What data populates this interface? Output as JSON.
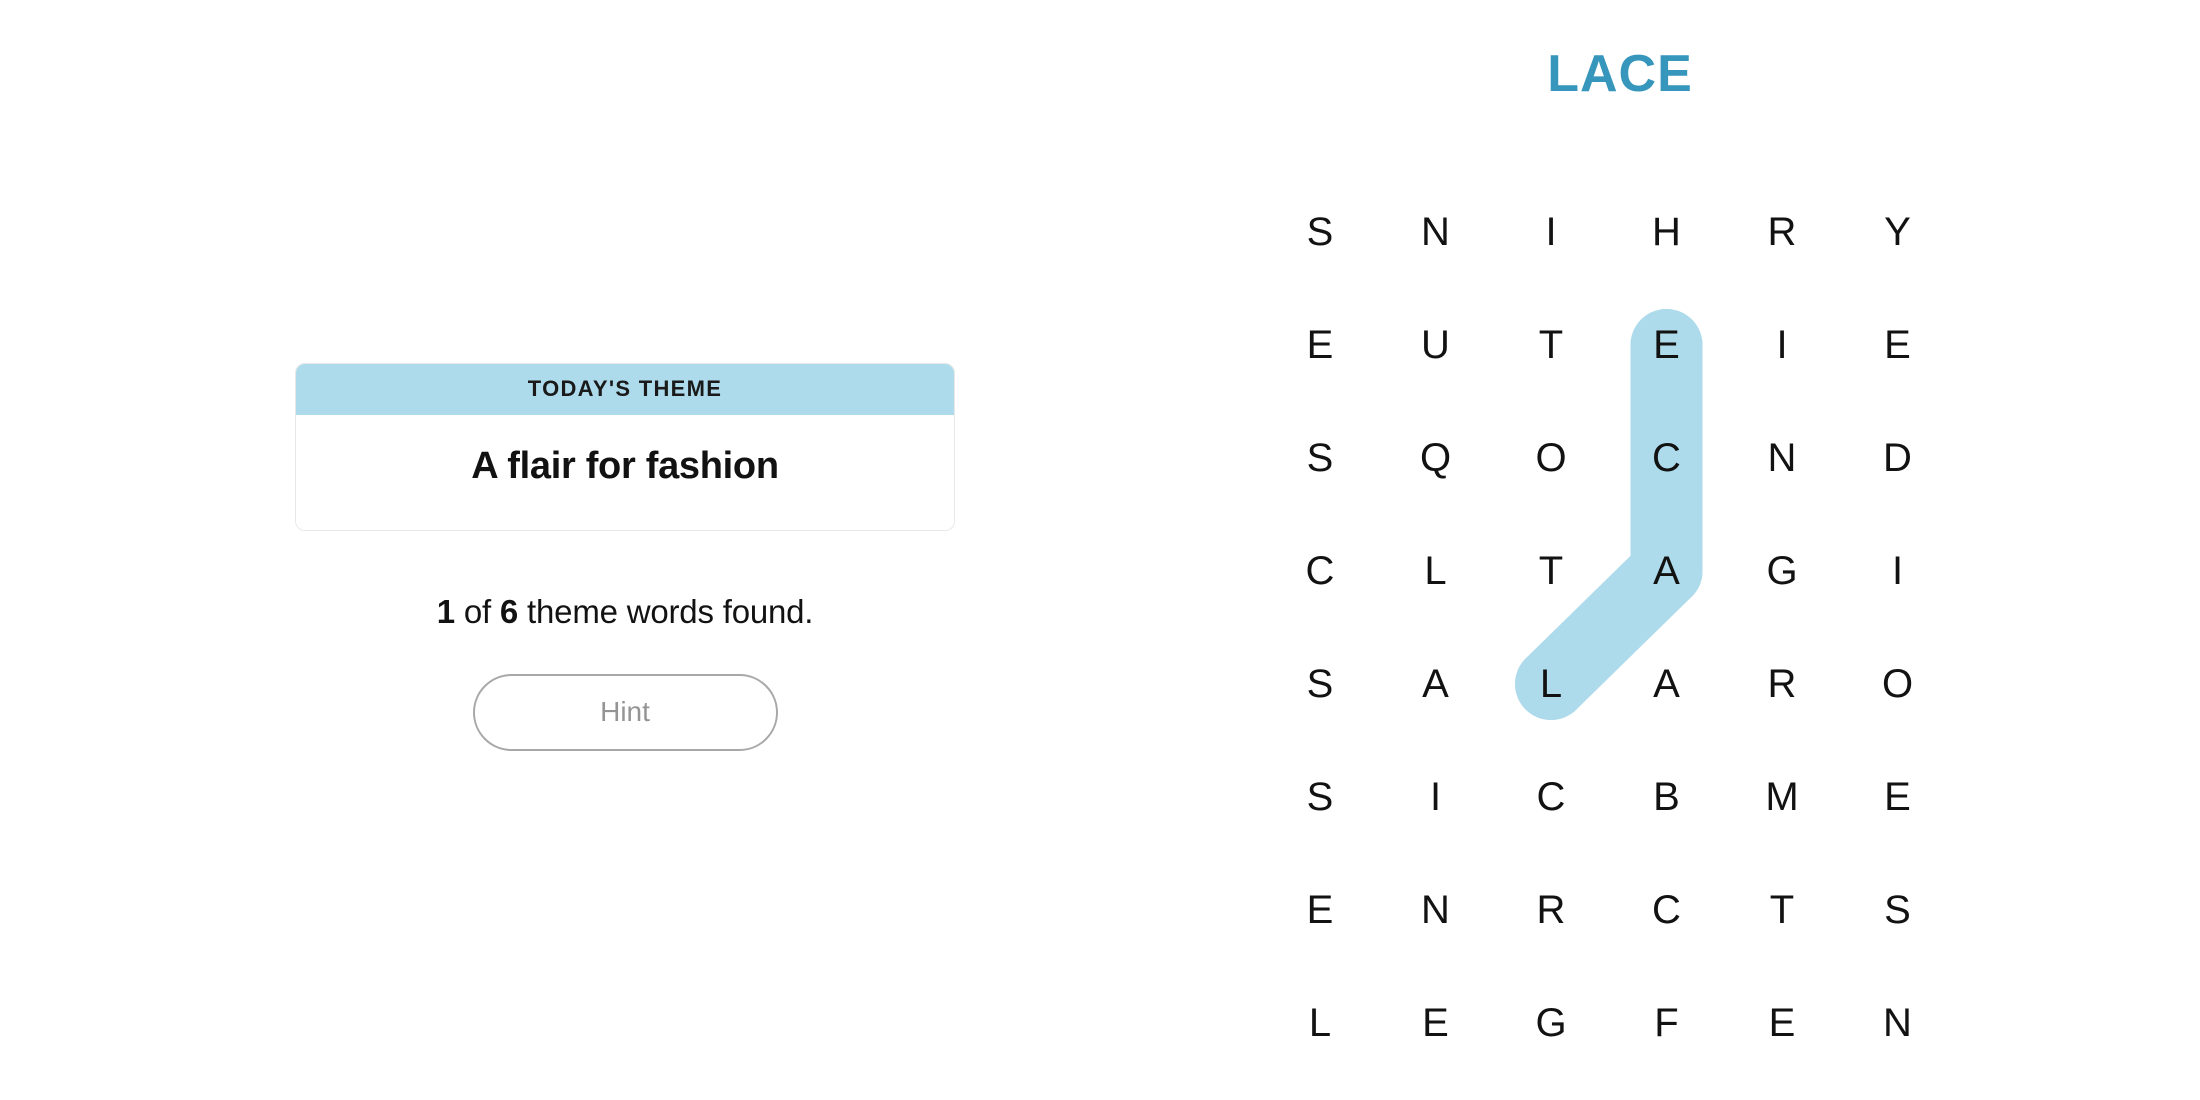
{
  "puzzle": {
    "title": "LACE",
    "title_color": "#3796bc"
  },
  "theme_card": {
    "header_label": "TODAY'S THEME",
    "theme_text": "A flair for fashion",
    "header_bg": "#addbeb"
  },
  "progress": {
    "found_count": "1",
    "connector_text": " of ",
    "total_count": "6",
    "suffix_text": " theme words found."
  },
  "hint": {
    "label": "Hint"
  },
  "grid": {
    "rows": 8,
    "cols": 6,
    "letters": [
      [
        "S",
        "N",
        "I",
        "H",
        "R",
        "Y"
      ],
      [
        "E",
        "U",
        "T",
        "E",
        "I",
        "E"
      ],
      [
        "S",
        "Q",
        "O",
        "C",
        "N",
        "D"
      ],
      [
        "C",
        "L",
        "T",
        "A",
        "G",
        "I"
      ],
      [
        "S",
        "A",
        "L",
        "A",
        "R",
        "O"
      ],
      [
        "S",
        "I",
        "C",
        "B",
        "M",
        "E"
      ],
      [
        "E",
        "N",
        "R",
        "C",
        "T",
        "S"
      ],
      [
        "L",
        "E",
        "G",
        "F",
        "E",
        "N"
      ]
    ],
    "highlight_color": "#addbeb",
    "selected_path": [
      {
        "row": 1,
        "col": 3,
        "letter": "E"
      },
      {
        "row": 2,
        "col": 3,
        "letter": "C"
      },
      {
        "row": 3,
        "col": 3,
        "letter": "A"
      },
      {
        "row": 4,
        "col": 2,
        "letter": "L"
      }
    ],
    "selected_word": "LACE"
  }
}
